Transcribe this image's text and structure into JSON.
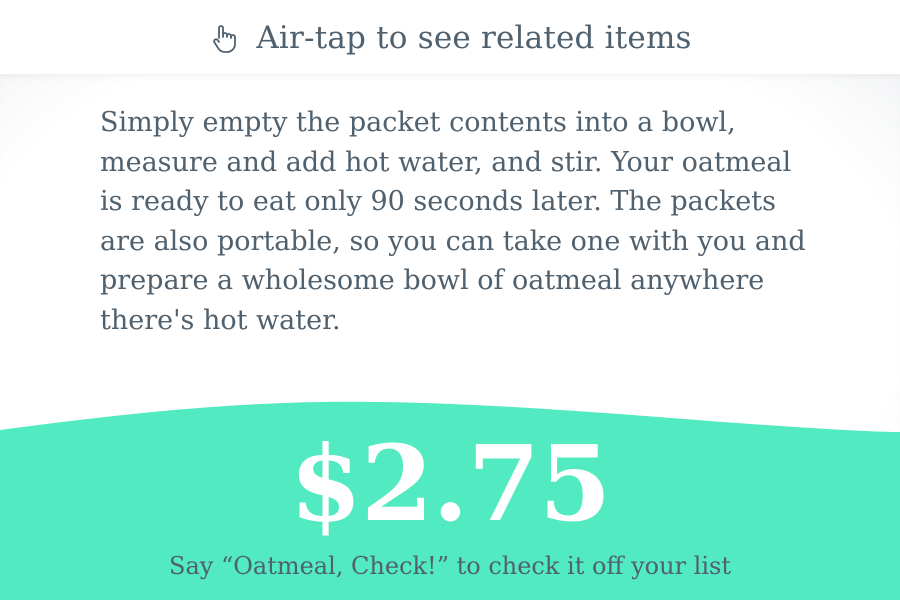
{
  "colors": {
    "accent": "#52eac1",
    "text": "#4f606e",
    "price_text": "#ffffff",
    "background": "#ffffff"
  },
  "header": {
    "icon": "hand-pointer-icon",
    "hint": "Air-tap to see related items"
  },
  "product": {
    "description": "Simply empty the packet contents into a bowl, measure and add hot water, and stir. Your oatmeal is ready to eat only 90 seconds later. The packets are also portable, so you can take one with you and prepare a wholesome bowl of oatmeal anywhere there's hot water.",
    "price": "$2.75",
    "voice_command_hint": "Say “Oatmeal, Check!” to check it off your list"
  }
}
